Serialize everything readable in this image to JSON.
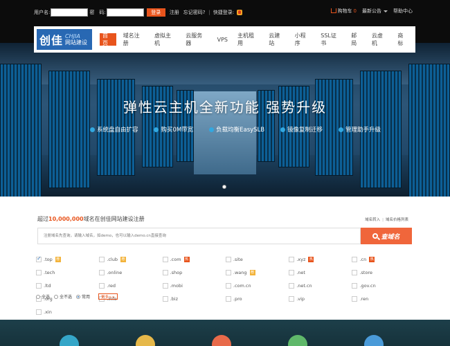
{
  "topbar": {
    "username_label": "用户名:",
    "username_value": "",
    "password_label": "密　码:",
    "password_value": "",
    "login_button": "登录",
    "register_link": "注册",
    "forgot_link": "忘记密码?",
    "quick_login": "快捷登录:",
    "cart_label": "购物车",
    "cart_count": "0",
    "announcement": "最新公告",
    "help": "帮助中心"
  },
  "logo": {
    "cn": "创佳",
    "en": "CHJIA",
    "sub": "网站建设"
  },
  "nav": {
    "items": [
      "首页",
      "域名注册",
      "虚拟主机",
      "云服务器",
      "VPS",
      "主机租用",
      "云建站",
      "小程序",
      "SSL证书",
      "邮局",
      "云虚机",
      "商标"
    ],
    "active": "首页"
  },
  "banner": {
    "title": "弹性云主机全新功能  强势升级",
    "features": [
      "系统盘自由扩容",
      "购买0M带宽",
      "负载均衡EasySLB",
      "镜像复制迁移",
      "管理助手升级"
    ]
  },
  "domain": {
    "title_prefix": "超过",
    "title_count": "10,000,000",
    "title_suffix": "域名在创佳网站建设注册",
    "link_transfer": "域名转入",
    "link_price": "域名价格列表",
    "search_placeholder": "注册域名先查询，请输入域名，如demo，也可以输入demo.cn直接查询",
    "search_button": "查域名",
    "tlds": [
      {
        "name": ".top",
        "checked": true,
        "tag": "rec"
      },
      {
        "name": ".club",
        "checked": false,
        "tag": "rec"
      },
      {
        "name": ".com",
        "checked": false,
        "tag": "hot"
      },
      {
        "name": ".site",
        "checked": false,
        "tag": ""
      },
      {
        "name": ".xyz",
        "checked": false,
        "tag": "hot"
      },
      {
        "name": ".cn",
        "checked": false,
        "tag": "hot"
      },
      {
        "name": ".tech",
        "checked": false,
        "tag": ""
      },
      {
        "name": ".online",
        "checked": false,
        "tag": ""
      },
      {
        "name": ".shop",
        "checked": false,
        "tag": ""
      },
      {
        "name": ".wang",
        "checked": false,
        "tag": "rec"
      },
      {
        "name": ".net",
        "checked": false,
        "tag": ""
      },
      {
        "name": ".store",
        "checked": false,
        "tag": ""
      },
      {
        "name": ".ltd",
        "checked": false,
        "tag": ""
      },
      {
        "name": ".red",
        "checked": false,
        "tag": ""
      },
      {
        "name": ".mobi",
        "checked": false,
        "tag": ""
      },
      {
        "name": ".com.cn",
        "checked": false,
        "tag": ""
      },
      {
        "name": ".net.cn",
        "checked": false,
        "tag": ""
      },
      {
        "name": ".gov.cn",
        "checked": false,
        "tag": ""
      },
      {
        "name": ".org",
        "checked": false,
        "tag": ""
      },
      {
        "name": ".info",
        "checked": false,
        "tag": ""
      },
      {
        "name": ".biz",
        "checked": false,
        "tag": ""
      },
      {
        "name": ".pro",
        "checked": false,
        "tag": ""
      },
      {
        "name": ".vip",
        "checked": false,
        "tag": ""
      },
      {
        "name": ".ren",
        "checked": false,
        "tag": ""
      },
      {
        "name": ".xin",
        "checked": false,
        "tag": ""
      }
    ],
    "tag_labels": {
      "hot": "热",
      "rec": "荐"
    },
    "select_all": "全选",
    "select_none": "全不选",
    "common": "常用",
    "more": "更多>>"
  },
  "colors": {
    "accent": "#e8541c",
    "brand": "#2868b3",
    "banner_blue": "#2c5577"
  }
}
